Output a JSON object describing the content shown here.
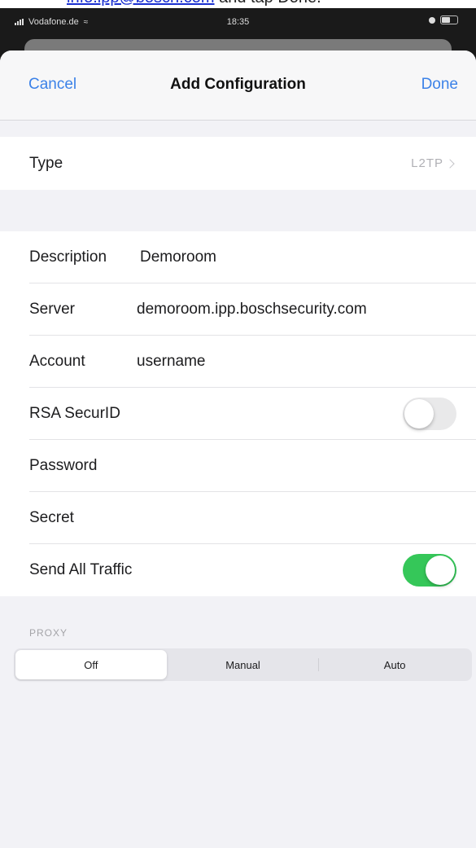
{
  "caption": {
    "link_text": "info.ipp@bosch.com",
    "rest_text": " and  tap Done."
  },
  "status_bar": {
    "carrier": "Vodafone.de",
    "time": "18:35"
  },
  "nav": {
    "cancel_label": "Cancel",
    "title": "Add Configuration",
    "done_label": "Done",
    "accent_color": "#3c82e8"
  },
  "type_row": {
    "label": "Type",
    "value": "L2TP"
  },
  "fields": {
    "description": {
      "label": "Description",
      "value": "Demoroom"
    },
    "server": {
      "label": "Server",
      "value": "demoroom.ipp.boschsecurity.com"
    },
    "account": {
      "label": "Account",
      "value": "username"
    },
    "rsa_securid": {
      "label": "RSA SecurID",
      "toggle": false
    },
    "password": {
      "label": "Password",
      "value": ""
    },
    "secret": {
      "label": "Secret",
      "value": ""
    },
    "send_all_traffic": {
      "label": "Send All Traffic",
      "toggle": true,
      "toggle_color": "#35c759"
    }
  },
  "proxy": {
    "header": "PROXY",
    "options": [
      "Off",
      "Manual",
      "Auto"
    ],
    "selected": "Off"
  }
}
